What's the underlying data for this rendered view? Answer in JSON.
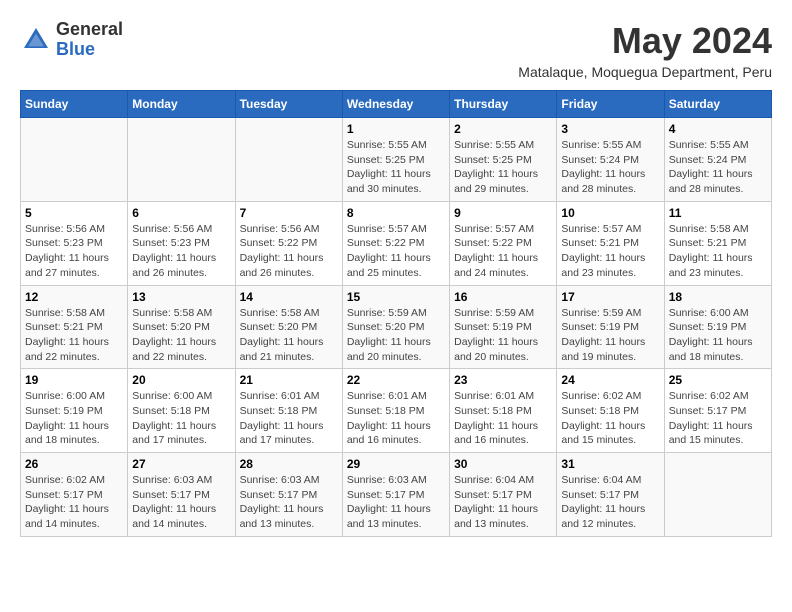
{
  "logo": {
    "general": "General",
    "blue": "Blue"
  },
  "title": "May 2024",
  "location": "Matalaque, Moquegua Department, Peru",
  "days_of_week": [
    "Sunday",
    "Monday",
    "Tuesday",
    "Wednesday",
    "Thursday",
    "Friday",
    "Saturday"
  ],
  "weeks": [
    [
      {
        "day": "",
        "info": ""
      },
      {
        "day": "",
        "info": ""
      },
      {
        "day": "",
        "info": ""
      },
      {
        "day": "1",
        "sunrise": "Sunrise: 5:55 AM",
        "sunset": "Sunset: 5:25 PM",
        "daylight": "Daylight: 11 hours and 30 minutes."
      },
      {
        "day": "2",
        "sunrise": "Sunrise: 5:55 AM",
        "sunset": "Sunset: 5:25 PM",
        "daylight": "Daylight: 11 hours and 29 minutes."
      },
      {
        "day": "3",
        "sunrise": "Sunrise: 5:55 AM",
        "sunset": "Sunset: 5:24 PM",
        "daylight": "Daylight: 11 hours and 28 minutes."
      },
      {
        "day": "4",
        "sunrise": "Sunrise: 5:55 AM",
        "sunset": "Sunset: 5:24 PM",
        "daylight": "Daylight: 11 hours and 28 minutes."
      }
    ],
    [
      {
        "day": "5",
        "sunrise": "Sunrise: 5:56 AM",
        "sunset": "Sunset: 5:23 PM",
        "daylight": "Daylight: 11 hours and 27 minutes."
      },
      {
        "day": "6",
        "sunrise": "Sunrise: 5:56 AM",
        "sunset": "Sunset: 5:23 PM",
        "daylight": "Daylight: 11 hours and 26 minutes."
      },
      {
        "day": "7",
        "sunrise": "Sunrise: 5:56 AM",
        "sunset": "Sunset: 5:22 PM",
        "daylight": "Daylight: 11 hours and 26 minutes."
      },
      {
        "day": "8",
        "sunrise": "Sunrise: 5:57 AM",
        "sunset": "Sunset: 5:22 PM",
        "daylight": "Daylight: 11 hours and 25 minutes."
      },
      {
        "day": "9",
        "sunrise": "Sunrise: 5:57 AM",
        "sunset": "Sunset: 5:22 PM",
        "daylight": "Daylight: 11 hours and 24 minutes."
      },
      {
        "day": "10",
        "sunrise": "Sunrise: 5:57 AM",
        "sunset": "Sunset: 5:21 PM",
        "daylight": "Daylight: 11 hours and 23 minutes."
      },
      {
        "day": "11",
        "sunrise": "Sunrise: 5:58 AM",
        "sunset": "Sunset: 5:21 PM",
        "daylight": "Daylight: 11 hours and 23 minutes."
      }
    ],
    [
      {
        "day": "12",
        "sunrise": "Sunrise: 5:58 AM",
        "sunset": "Sunset: 5:21 PM",
        "daylight": "Daylight: 11 hours and 22 minutes."
      },
      {
        "day": "13",
        "sunrise": "Sunrise: 5:58 AM",
        "sunset": "Sunset: 5:20 PM",
        "daylight": "Daylight: 11 hours and 22 minutes."
      },
      {
        "day": "14",
        "sunrise": "Sunrise: 5:58 AM",
        "sunset": "Sunset: 5:20 PM",
        "daylight": "Daylight: 11 hours and 21 minutes."
      },
      {
        "day": "15",
        "sunrise": "Sunrise: 5:59 AM",
        "sunset": "Sunset: 5:20 PM",
        "daylight": "Daylight: 11 hours and 20 minutes."
      },
      {
        "day": "16",
        "sunrise": "Sunrise: 5:59 AM",
        "sunset": "Sunset: 5:19 PM",
        "daylight": "Daylight: 11 hours and 20 minutes."
      },
      {
        "day": "17",
        "sunrise": "Sunrise: 5:59 AM",
        "sunset": "Sunset: 5:19 PM",
        "daylight": "Daylight: 11 hours and 19 minutes."
      },
      {
        "day": "18",
        "sunrise": "Sunrise: 6:00 AM",
        "sunset": "Sunset: 5:19 PM",
        "daylight": "Daylight: 11 hours and 18 minutes."
      }
    ],
    [
      {
        "day": "19",
        "sunrise": "Sunrise: 6:00 AM",
        "sunset": "Sunset: 5:19 PM",
        "daylight": "Daylight: 11 hours and 18 minutes."
      },
      {
        "day": "20",
        "sunrise": "Sunrise: 6:00 AM",
        "sunset": "Sunset: 5:18 PM",
        "daylight": "Daylight: 11 hours and 17 minutes."
      },
      {
        "day": "21",
        "sunrise": "Sunrise: 6:01 AM",
        "sunset": "Sunset: 5:18 PM",
        "daylight": "Daylight: 11 hours and 17 minutes."
      },
      {
        "day": "22",
        "sunrise": "Sunrise: 6:01 AM",
        "sunset": "Sunset: 5:18 PM",
        "daylight": "Daylight: 11 hours and 16 minutes."
      },
      {
        "day": "23",
        "sunrise": "Sunrise: 6:01 AM",
        "sunset": "Sunset: 5:18 PM",
        "daylight": "Daylight: 11 hours and 16 minutes."
      },
      {
        "day": "24",
        "sunrise": "Sunrise: 6:02 AM",
        "sunset": "Sunset: 5:18 PM",
        "daylight": "Daylight: 11 hours and 15 minutes."
      },
      {
        "day": "25",
        "sunrise": "Sunrise: 6:02 AM",
        "sunset": "Sunset: 5:17 PM",
        "daylight": "Daylight: 11 hours and 15 minutes."
      }
    ],
    [
      {
        "day": "26",
        "sunrise": "Sunrise: 6:02 AM",
        "sunset": "Sunset: 5:17 PM",
        "daylight": "Daylight: 11 hours and 14 minutes."
      },
      {
        "day": "27",
        "sunrise": "Sunrise: 6:03 AM",
        "sunset": "Sunset: 5:17 PM",
        "daylight": "Daylight: 11 hours and 14 minutes."
      },
      {
        "day": "28",
        "sunrise": "Sunrise: 6:03 AM",
        "sunset": "Sunset: 5:17 PM",
        "daylight": "Daylight: 11 hours and 13 minutes."
      },
      {
        "day": "29",
        "sunrise": "Sunrise: 6:03 AM",
        "sunset": "Sunset: 5:17 PM",
        "daylight": "Daylight: 11 hours and 13 minutes."
      },
      {
        "day": "30",
        "sunrise": "Sunrise: 6:04 AM",
        "sunset": "Sunset: 5:17 PM",
        "daylight": "Daylight: 11 hours and 13 minutes."
      },
      {
        "day": "31",
        "sunrise": "Sunrise: 6:04 AM",
        "sunset": "Sunset: 5:17 PM",
        "daylight": "Daylight: 11 hours and 12 minutes."
      },
      {
        "day": "",
        "info": ""
      }
    ]
  ]
}
